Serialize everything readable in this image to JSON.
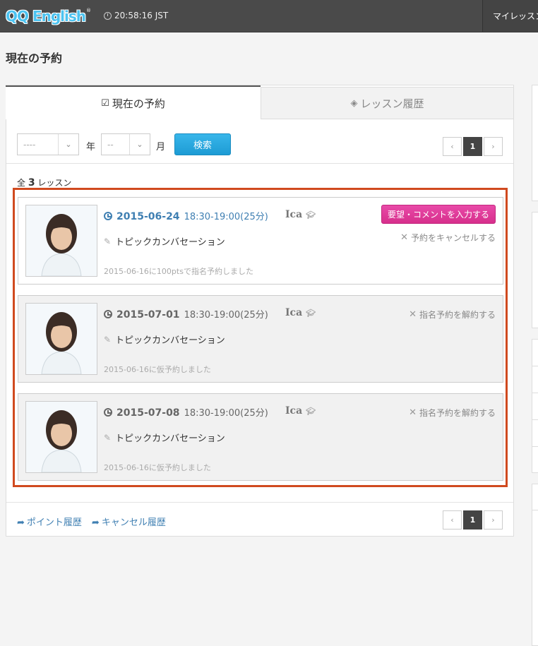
{
  "header": {
    "logo_text": "QQ English",
    "logo_reg": "®",
    "time": "20:58:16 JST",
    "my_lesson": "マイレッスン"
  },
  "page_title": "現在の予約",
  "tabs": [
    {
      "label": "現在の予約",
      "icon": "clipboard-check-icon",
      "active": true
    },
    {
      "label": "レッスン履歴",
      "icon": "layers-icon",
      "active": false
    }
  ],
  "filter": {
    "year_value": "----",
    "year_unit": "年",
    "month_value": "--",
    "month_unit": "月",
    "search_label": "検索"
  },
  "pager": {
    "prev": "‹",
    "page": "1",
    "next": "›"
  },
  "total": {
    "prefix": "全",
    "count": "3",
    "suffix": "レッスン"
  },
  "lessons": [
    {
      "date": "2015-06-24",
      "time": "18:30-19:00(25分)",
      "teacher": "Ica",
      "topic": "トピックカンバセーション",
      "note": "2015-06-16に100ptsで指名予約しました",
      "request_button": "要望・コメントを入力する",
      "cancel_label": "予約をキャンセルする"
    },
    {
      "date": "2015-07-01",
      "time": "18:30-19:00(25分)",
      "teacher": "Ica",
      "topic": "トピックカンバセーション",
      "note": "2015-06-16に仮予約しました",
      "cancel_label": "指名予約を解約する"
    },
    {
      "date": "2015-07-08",
      "time": "18:30-19:00(25分)",
      "teacher": "Ica",
      "topic": "トピックカンバセーション",
      "note": "2015-06-16に仮予約しました",
      "cancel_label": "指名予約を解約する"
    }
  ],
  "footer": {
    "point_history": "ポイント履歴",
    "cancel_history": "キャンセル履歴"
  },
  "colors": {
    "accent_blue": "#3f7fb2",
    "search_button": "#1d9bd4",
    "request_button": "#d72f8c",
    "highlight_border": "#d04a1f",
    "header_bg": "#4a4a4a"
  }
}
